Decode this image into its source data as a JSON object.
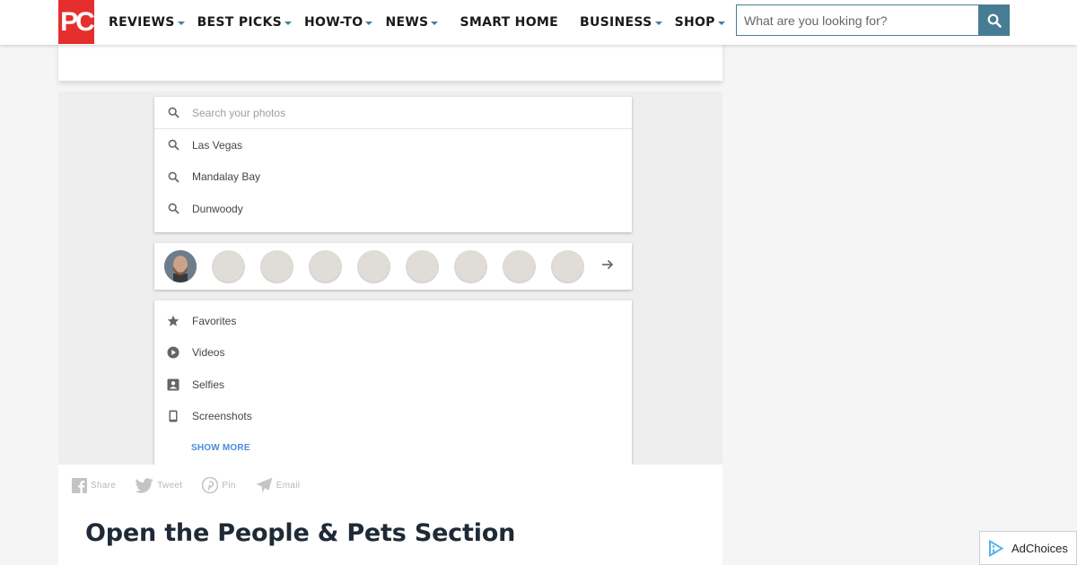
{
  "header": {
    "logo_text": "PC",
    "nav": [
      {
        "label": "REVIEWS",
        "has_caret": true
      },
      {
        "label": "BEST PICKS",
        "has_caret": true
      },
      {
        "label": "HOW-TO",
        "has_caret": true
      },
      {
        "label": "NEWS",
        "has_caret": true
      },
      {
        "label": "SMART HOME",
        "has_caret": false
      },
      {
        "label": "BUSINESS",
        "has_caret": true
      },
      {
        "label": "SHOP",
        "has_caret": true
      }
    ],
    "search": {
      "placeholder": "What are you looking for?"
    }
  },
  "article_image": {
    "search_placeholder": "Search your photos",
    "suggestions": [
      "Las Vegas",
      "Mandalay Bay",
      "Dunwoody"
    ],
    "categories": [
      {
        "label": "Favorites",
        "icon": "star-icon"
      },
      {
        "label": "Videos",
        "icon": "play-icon"
      },
      {
        "label": "Selfies",
        "icon": "selfie-icon"
      },
      {
        "label": "Screenshots",
        "icon": "phone-icon"
      }
    ],
    "show_more": "SHOW MORE"
  },
  "share": {
    "facebook": "Share",
    "twitter": "Tweet",
    "pinterest": "Pin",
    "email": "Email"
  },
  "section_title": "Open the People & Pets Section",
  "adchoices": "AdChoices",
  "colors": {
    "brand_red": "#e62e2d",
    "nav_accent": "#3d7ea0",
    "search_button": "#467c94",
    "show_more_blue": "#4a8cdc",
    "title": "#1f2a36"
  }
}
